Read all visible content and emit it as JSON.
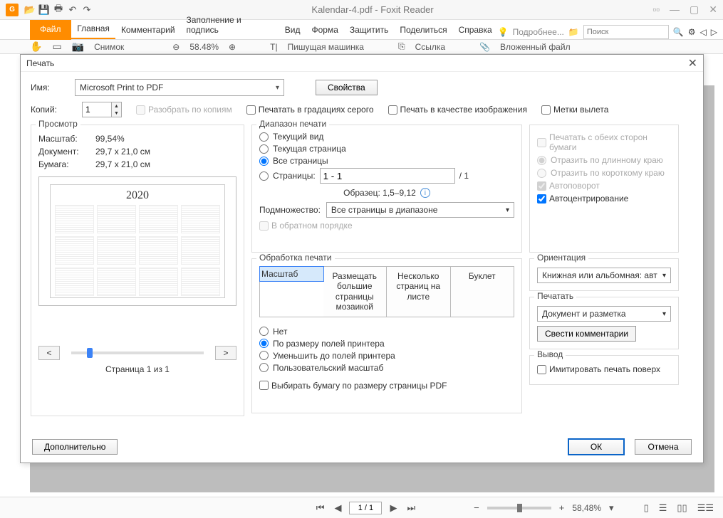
{
  "app": {
    "title": "Kalendar-4.pdf - Foxit Reader",
    "logo_letter": "G"
  },
  "ribbon": {
    "file": "Файл",
    "tabs": [
      "Главная",
      "Комментарий",
      "Заполнение и подпись",
      "Вид",
      "Форма",
      "Защитить",
      "Поделиться",
      "Справка"
    ],
    "more": "Подробнее...",
    "search_placeholder": "Поиск"
  },
  "ribbon_body": {
    "snapshot": "Снимок",
    "zoom": "58.48%",
    "typewriter": "Пишущая машинка",
    "link": "Ссылка",
    "attach": "Вложенный файл"
  },
  "print": {
    "title": "Печать",
    "name_label": "Имя:",
    "printer": "Microsoft Print to PDF",
    "properties": "Свойства",
    "copies_label": "Копий:",
    "copies": "1",
    "collate": "Разобрать по копиям",
    "grayscale": "Печатать в градациях серого",
    "as_image": "Печать в качестве изображения",
    "bleed": "Метки вылета"
  },
  "preview": {
    "legend": "Просмотр",
    "scale_label": "Масштаб:",
    "scale": "99,54%",
    "doc_label": "Документ:",
    "doc": "29,7 x 21,0 см",
    "paper_label": "Бумага:",
    "paper": "29,7 x 21,0 см",
    "year": "2020",
    "prev": "<",
    "next": ">",
    "page_of": "Страница 1 из 1"
  },
  "range": {
    "legend": "Диапазон печати",
    "current_view": "Текущий вид",
    "current_page": "Текущая страница",
    "all_pages": "Все страницы",
    "pages_label": "Страницы:",
    "pages_value": "1 - 1",
    "pages_total": "/ 1",
    "sample": "Образец: 1,5–9,12",
    "subset_label": "Подмножество:",
    "subset_value": "Все страницы в диапазоне",
    "reverse": "В обратном порядке"
  },
  "handling": {
    "legend": "Обработка печати",
    "tab_scale": "Масштаб",
    "tab_tile": "Размещать большие страницы мозаикой",
    "tab_multi": "Несколько страниц на листе",
    "tab_booklet": "Буклет",
    "none": "Нет",
    "fit_margins": "По размеру полей принтера",
    "shrink": "Уменьшить до полей принтера",
    "custom": "Пользовательский масштаб",
    "choose_paper": "Выбирать бумагу по размеру страницы PDF"
  },
  "duplex": {
    "both_sides": "Печатать с обеих сторон бумаги",
    "flip_long": "Отразить по длинному краю",
    "flip_short": "Отразить по короткому краю",
    "autorotate": "Автоповорот",
    "autocenter": "Автоцентрирование"
  },
  "orientation": {
    "legend": "Ориентация",
    "value": "Книжная или альбомная: авт"
  },
  "what": {
    "legend": "Печатать",
    "value": "Документ и разметка",
    "summarize": "Свести комментарии"
  },
  "output": {
    "legend": "Вывод",
    "simulate": "Имитировать печать поверх"
  },
  "footer": {
    "advanced": "Дополнительно",
    "ok": "ОК",
    "cancel": "Отмена"
  },
  "status": {
    "page": "1 / 1",
    "zoom": "58,48%"
  }
}
